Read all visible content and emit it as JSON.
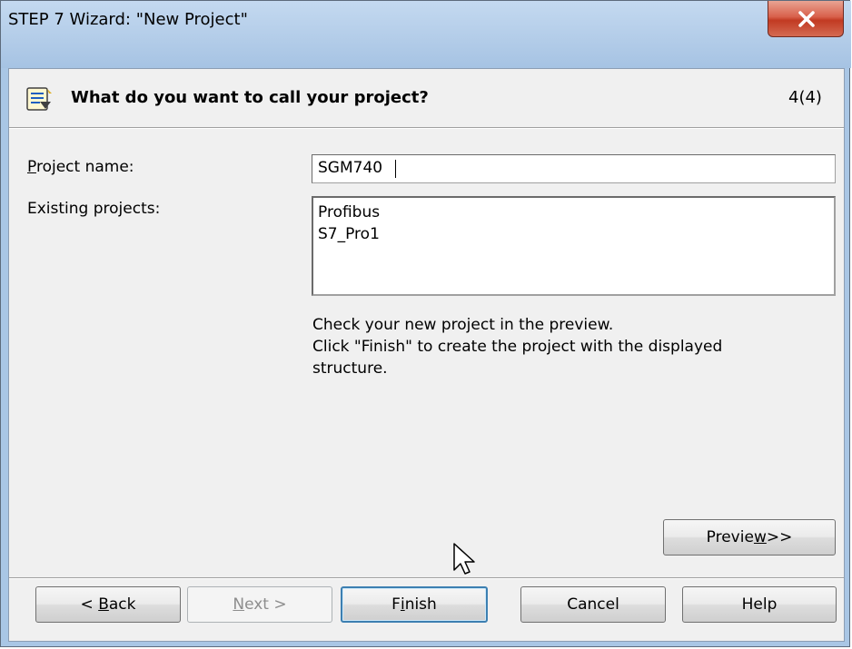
{
  "window": {
    "title": "STEP 7 Wizard: \"New Project\""
  },
  "header": {
    "question": "What do you want to call your project?",
    "step": "4(4)",
    "icon": "wizard-icon"
  },
  "form": {
    "project_name_label_prefix": "",
    "project_name_label_mnemonic": "P",
    "project_name_label_rest": "roject name:",
    "project_name_value": "SGM740",
    "existing_projects_label": "Existing projects:",
    "existing_projects": [
      "Profibus",
      "S7_Pro1"
    ],
    "info_line1": "Check your new project in the preview.",
    "info_line2": "Click \"Finish\" to create the project with the displayed",
    "info_line3": "structure."
  },
  "buttons": {
    "preview_prefix": "Previe",
    "preview_mnemonic": "w",
    "preview_suffix": ">>",
    "back_prefix": "< ",
    "back_mnemonic": "B",
    "back_suffix": "ack",
    "next_mnemonic": "N",
    "next_suffix": "ext >",
    "finish_prefix": "F",
    "finish_mnemonic": "i",
    "finish_suffix": "nish",
    "cancel_label": "Cancel",
    "help_label": "Help"
  },
  "colors": {
    "titlebar": "#a9c6e5",
    "dialog_bg": "#f0f0f0",
    "close_button": "#c23a22",
    "default_button_border": "#3c7fb1"
  }
}
